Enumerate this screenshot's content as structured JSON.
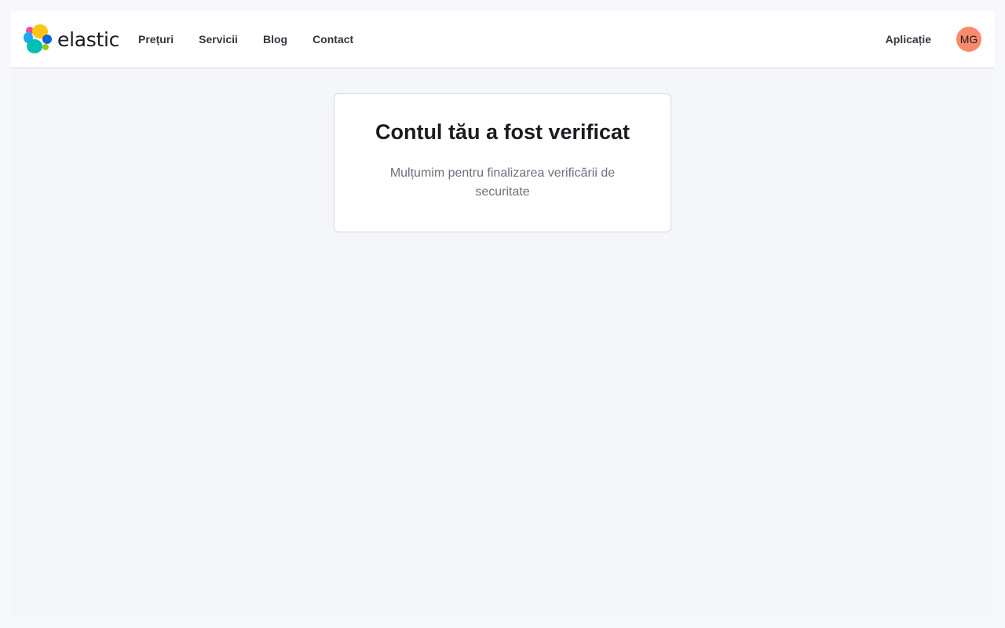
{
  "header": {
    "logo": {
      "text": "elastic",
      "icon": "elastic-cluster-icon",
      "colors": [
        "#f04e98",
        "#fec514",
        "#1ba9f5",
        "#0b64dd",
        "#00bfb3",
        "#93c90e"
      ]
    },
    "nav": [
      {
        "label": "Prețuri"
      },
      {
        "label": "Servicii"
      },
      {
        "label": "Blog"
      },
      {
        "label": "Contact"
      }
    ],
    "app_link": "Aplicație",
    "avatar": {
      "initials": "MG",
      "color": "#f88b6c"
    }
  },
  "main": {
    "card": {
      "title": "Contul tău a fost verificat",
      "message": "Mulțumim pentru finalizarea verificării de securitate"
    }
  }
}
